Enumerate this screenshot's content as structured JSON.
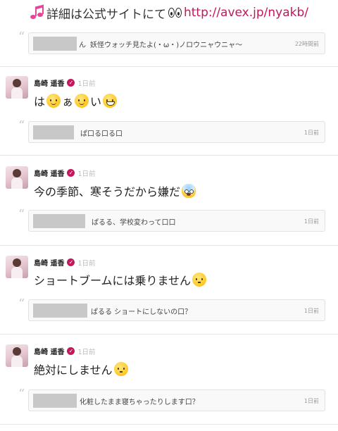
{
  "header": {
    "prefix_text": "詳細は公式サイトにて",
    "link_text": "http://avex.jp/nyakb/",
    "icons": [
      "music-note-icon",
      "eyes-icon"
    ]
  },
  "first_reply": {
    "name_suffix": "ん",
    "text": "妖怪ウォッチ見たよ(・ω・)ノロウニャウニャ〜",
    "time": "22時間前"
  },
  "posts": [
    {
      "user": "島崎 遥香",
      "time": "1日前",
      "message_parts": [
        "は",
        "ぁ",
        "い"
      ],
      "emojis": [
        "smile-face-icon",
        "smile-face-icon",
        "grin-face-icon"
      ],
      "reply": {
        "text": "ぱ口る口る口",
        "time": "1日前"
      }
    },
    {
      "user": "島崎 遥香",
      "time": "1日前",
      "message_parts": [
        "今の季節、寒そうだから嫌だ"
      ],
      "emojis": [
        "fearful-face-icon"
      ],
      "reply": {
        "text": "ぱるる、学校変わって口口",
        "time": "1日前"
      }
    },
    {
      "user": "島崎 遥香",
      "time": "1日前",
      "message_parts": [
        "ショートブームには乗りません"
      ],
      "emojis": [
        "neutral-face-icon"
      ],
      "reply": {
        "text": "ぱるる ショートにしないの口？",
        "time": "1日前"
      }
    },
    {
      "user": "島崎 遥香",
      "time": "1日前",
      "message_parts": [
        "絶対にしません"
      ],
      "emojis": [
        "neutral-face-icon"
      ],
      "reply": {
        "text": "化粧したまま寝ちゃったりします口？",
        "time": "1日前"
      }
    }
  ],
  "colors": {
    "accent": "#c2185b",
    "reply_bg": "#f9f9f9",
    "divider": "#e6e6e6"
  }
}
